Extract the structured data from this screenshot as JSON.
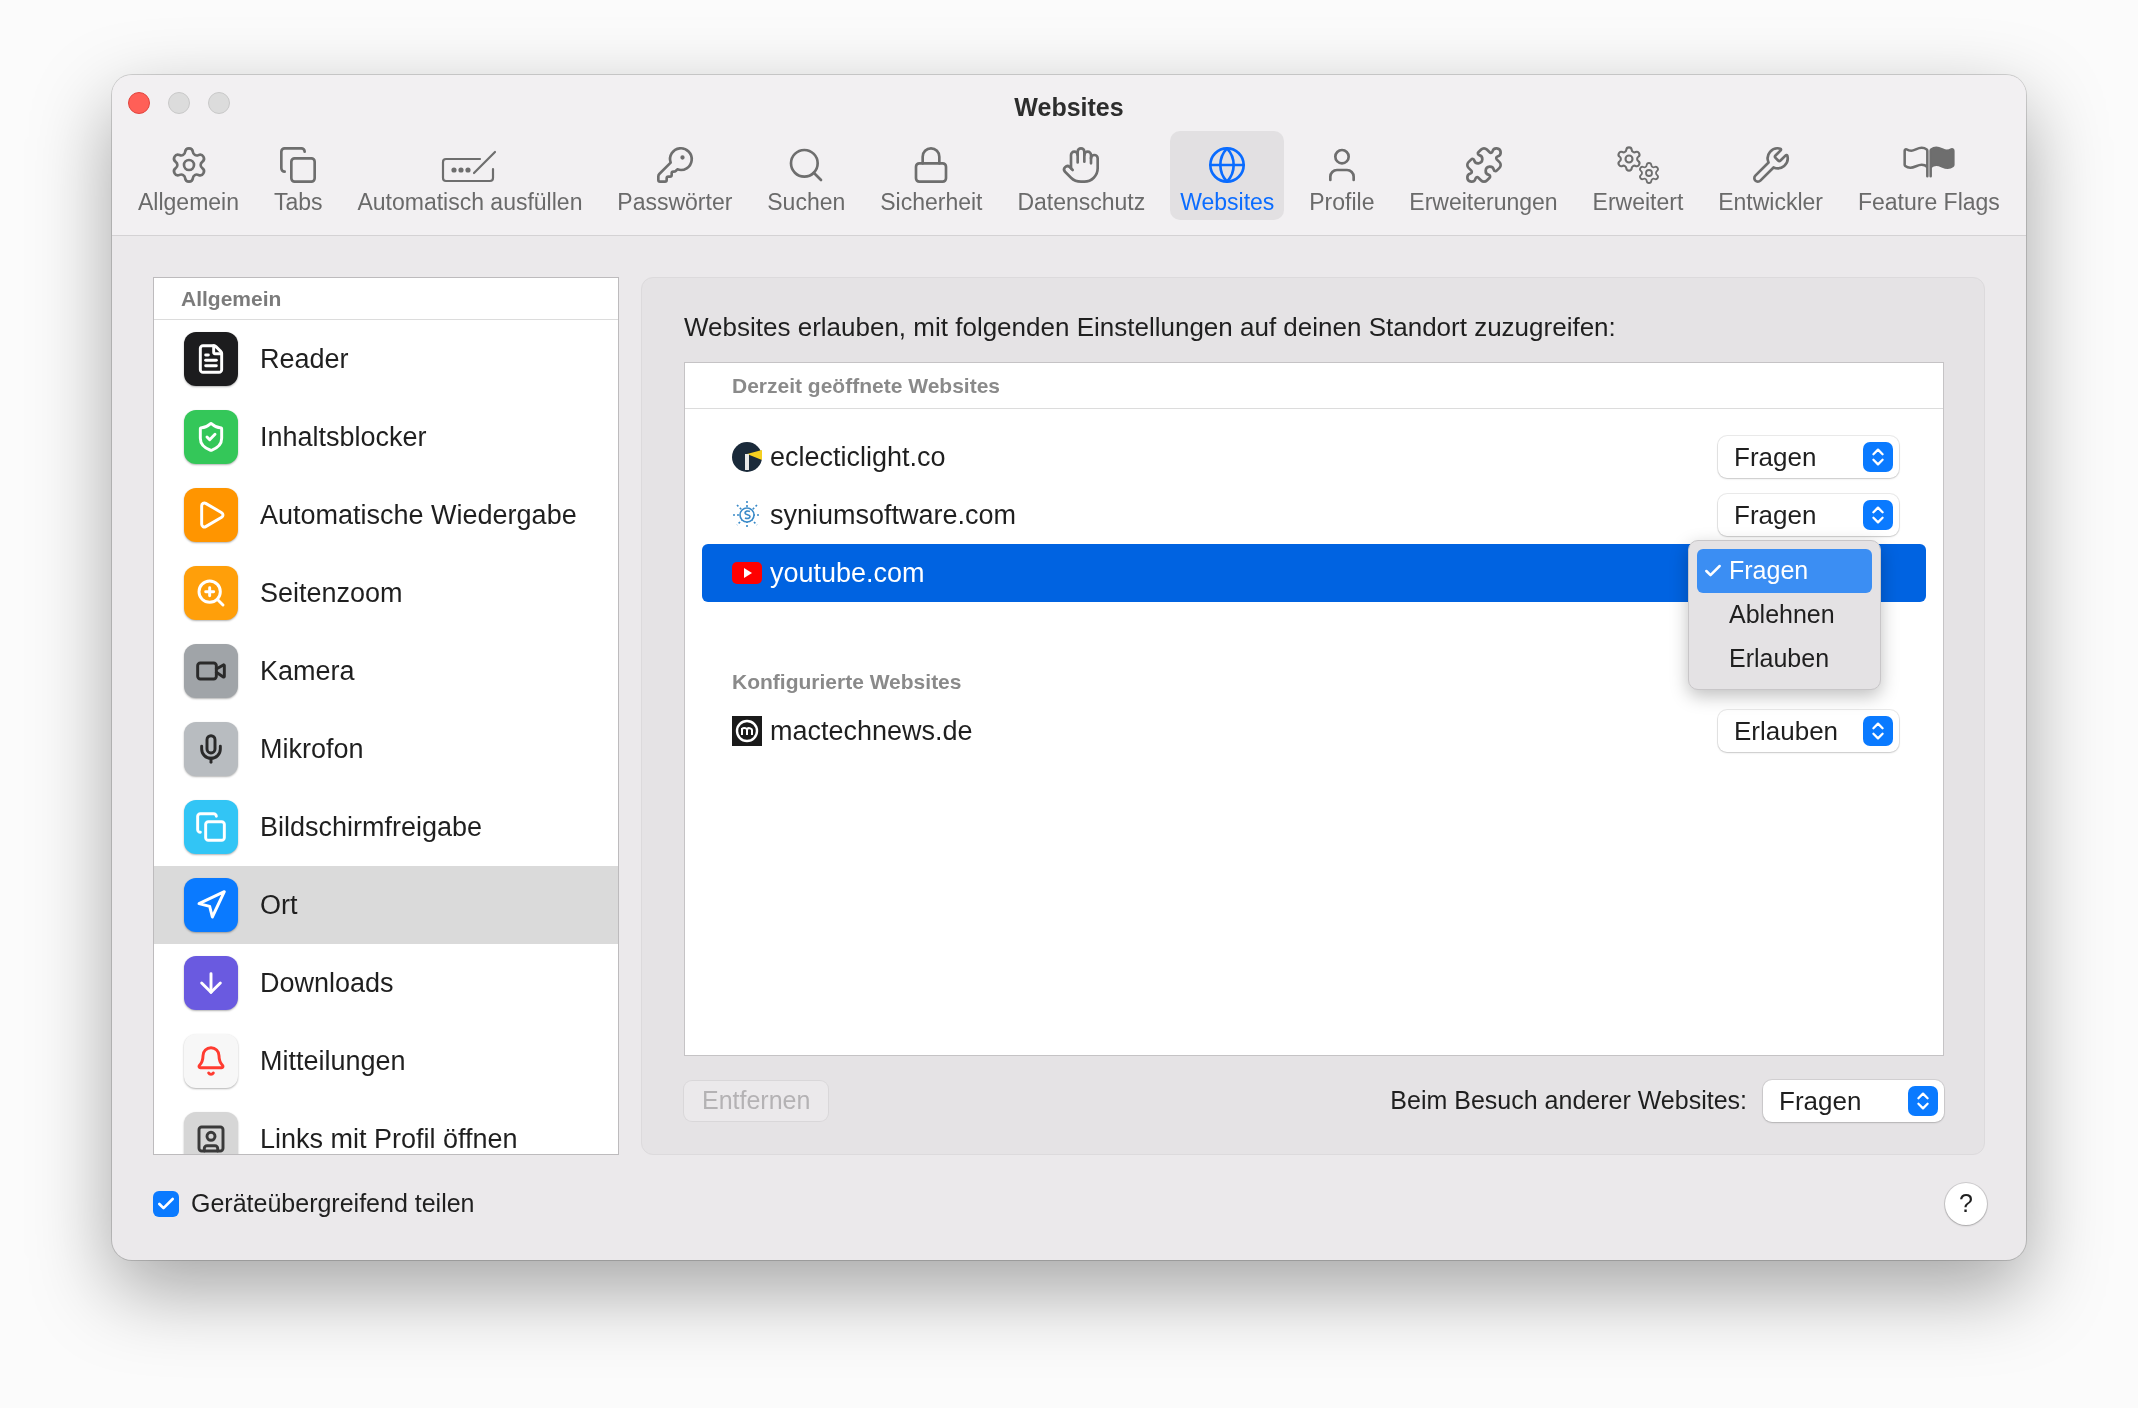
{
  "window": {
    "title": "Websites"
  },
  "toolbar": [
    {
      "label": "Allgemein",
      "kind": "general",
      "selected": false
    },
    {
      "label": "Tabs",
      "kind": "tabs",
      "selected": false
    },
    {
      "label": "Automatisch ausfüllen",
      "kind": "autofill",
      "selected": false
    },
    {
      "label": "Passwörter",
      "kind": "passwords",
      "selected": false
    },
    {
      "label": "Suchen",
      "kind": "search",
      "selected": false
    },
    {
      "label": "Sicherheit",
      "kind": "security",
      "selected": false
    },
    {
      "label": "Datenschutz",
      "kind": "privacy",
      "selected": false
    },
    {
      "label": "Websites",
      "kind": "websites",
      "selected": true
    },
    {
      "label": "Profile",
      "kind": "profiles",
      "selected": false
    },
    {
      "label": "Erweiterungen",
      "kind": "extensions",
      "selected": false
    },
    {
      "label": "Erweitert",
      "kind": "advanced",
      "selected": false
    },
    {
      "label": "Entwickler",
      "kind": "developer",
      "selected": false
    },
    {
      "label": "Feature Flags",
      "kind": "flags",
      "selected": false
    }
  ],
  "sidebar": {
    "header": "Allgemein",
    "items": [
      {
        "label": "Reader",
        "kind": "reader",
        "selected": false
      },
      {
        "label": "Inhaltsblocker",
        "kind": "blocker",
        "selected": false
      },
      {
        "label": "Automatische Wiedergabe",
        "kind": "autoplay",
        "selected": false
      },
      {
        "label": "Seitenzoom",
        "kind": "zoom",
        "selected": false
      },
      {
        "label": "Kamera",
        "kind": "camera",
        "selected": false
      },
      {
        "label": "Mikrofon",
        "kind": "microphone",
        "selected": false
      },
      {
        "label": "Bildschirmfreigabe",
        "kind": "screenshare",
        "selected": false
      },
      {
        "label": "Ort",
        "kind": "location",
        "selected": true
      },
      {
        "label": "Downloads",
        "kind": "downloads",
        "selected": false
      },
      {
        "label": "Mitteilungen",
        "kind": "notifications",
        "selected": false
      },
      {
        "label": "Links mit Profil öffnen",
        "kind": "profilelinks",
        "selected": false
      }
    ]
  },
  "panel": {
    "description": "Websites erlauben, mit folgenden Einstellungen auf deinen Standort zuzugreifen:",
    "sections": [
      {
        "title": "Derzeit geöffnete Websites",
        "sites": [
          {
            "name": "eclecticlight.co",
            "kind": "lighthouse",
            "selected": false,
            "setting": "Fragen"
          },
          {
            "name": "syniumsoftware.com",
            "kind": "synium",
            "selected": false,
            "setting": "Fragen"
          },
          {
            "name": "youtube.com",
            "kind": "youtube",
            "selected": true,
            "menu": [
              {
                "label": "Fragen",
                "selected": true
              },
              {
                "label": "Ablehnen",
                "selected": false
              },
              {
                "label": "Erlauben",
                "selected": false
              }
            ]
          }
        ]
      },
      {
        "title": "Konfigurierte Websites",
        "sites": [
          {
            "name": "mactechnews.de",
            "kind": "mtn",
            "selected": false,
            "setting": "Erlauben"
          }
        ]
      }
    ],
    "remove_button": {
      "label": "Entfernen",
      "disabled": true
    },
    "other_sites": {
      "label": "Beim Besuch anderer Websites:",
      "setting": "Fragen"
    }
  },
  "footer": {
    "share": {
      "label": "Geräteübergreifend teilen",
      "checked": true
    },
    "help": "?"
  }
}
